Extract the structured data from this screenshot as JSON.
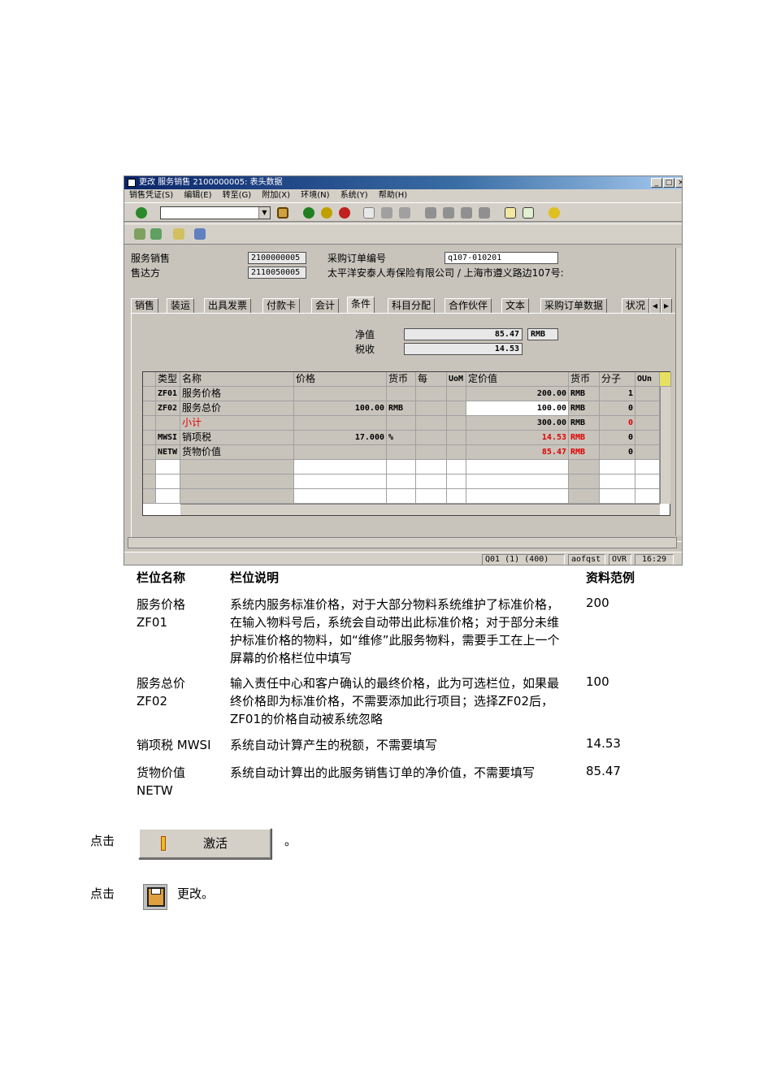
{
  "window": {
    "title": "更改 服务销售 2100000005: 表头数据",
    "menu": [
      "销售凭证(S)",
      "编辑(E)",
      "转至(G)",
      "附加(X)",
      "环境(N)",
      "系统(Y)",
      "帮助(H)"
    ]
  },
  "header": {
    "service_sale_label": "服务销售",
    "service_sale_value": "2100000005",
    "po_label": "采购订单编号",
    "po_value": "q107-010201",
    "sold_to_label": "售达方",
    "sold_to_value": "2110050005",
    "sold_to_name": "太平洋安泰人寿保险有限公司 / 上海市遵义路边107号:"
  },
  "tabs": [
    "销售",
    "装运",
    "出具发票",
    "付款卡",
    "会计",
    "条件",
    "科目分配",
    "合作伙伴",
    "文本",
    "采购订单数据",
    "状况"
  ],
  "active_tab": "条件",
  "totals": {
    "net_label": "净值",
    "net_value": "85.47",
    "net_currency": "RMB",
    "tax_label": "税收",
    "tax_value": "14.53"
  },
  "grid": {
    "headers": [
      "类型",
      "名称",
      "价格",
      "货币",
      "每",
      "UoM",
      "定价值",
      "货币",
      "分子",
      "OUn"
    ],
    "rows": [
      {
        "type": "ZF01",
        "name": "服务价格",
        "price": "",
        "cur": "",
        "per": "",
        "uom": "",
        "value": "200.00",
        "vcur": "RMB",
        "num": "1"
      },
      {
        "type": "ZF02",
        "name": "服务总价",
        "price": "100.00",
        "cur": "RMB",
        "per": "",
        "uom": "",
        "value": "100.00",
        "vcur": "RMB",
        "num": "0"
      },
      {
        "type": "",
        "name": "小计",
        "price": "",
        "cur": "",
        "per": "",
        "uom": "",
        "value": "300.00",
        "vcur": "RMB",
        "num": "0"
      },
      {
        "type": "MWSI",
        "name": "销项税",
        "price": "17.000",
        "cur": "%",
        "per": "",
        "uom": "",
        "value": "14.53",
        "vcur": "RMB",
        "num": "0"
      },
      {
        "type": "NETW",
        "name": "货物价值",
        "price": "",
        "cur": "",
        "per": "",
        "uom": "",
        "value": "85.47",
        "vcur": "RMB",
        "num": "0"
      }
    ]
  },
  "status": {
    "system": "Q01 (1) (400)",
    "server": "aofqst",
    "mode": "OVR",
    "time": "16:29"
  },
  "desc_table": {
    "headers": [
      "栏位名称",
      "栏位说明",
      "资料范例"
    ],
    "rows": [
      {
        "name": "服务价格 ZF01",
        "desc": "系统内服务标准价格，对于大部分物料系统维护了标准价格，在输入物料号后，系统会自动带出此标准价格；对于部分未维护标准价格的物料，如“维修”此服务物料，需要手工在上一个屏幕的价格栏位中填写",
        "example": "200"
      },
      {
        "name": "服务总价 ZF02",
        "desc": "输入责任中心和客户确认的最终价格，此为可选栏位，如果最终价格即为标准价格，不需要添加此行项目；选择ZF02后，ZF01的价格自动被系统忽略",
        "example": "100"
      },
      {
        "name": "销项税 MWSI",
        "desc": "系统自动计算产生的税额，不需要填写",
        "example": "14.53"
      },
      {
        "name": "货物价值 NETW",
        "desc": "系统自动计算出的此服务销售订单的净价值，不需要填写",
        "example": "85.47"
      }
    ]
  },
  "steps": {
    "click_label_1": "点击",
    "activate_button": "激活",
    "after_1": "。",
    "click_label_2": "点击",
    "after_2": "更改。"
  }
}
